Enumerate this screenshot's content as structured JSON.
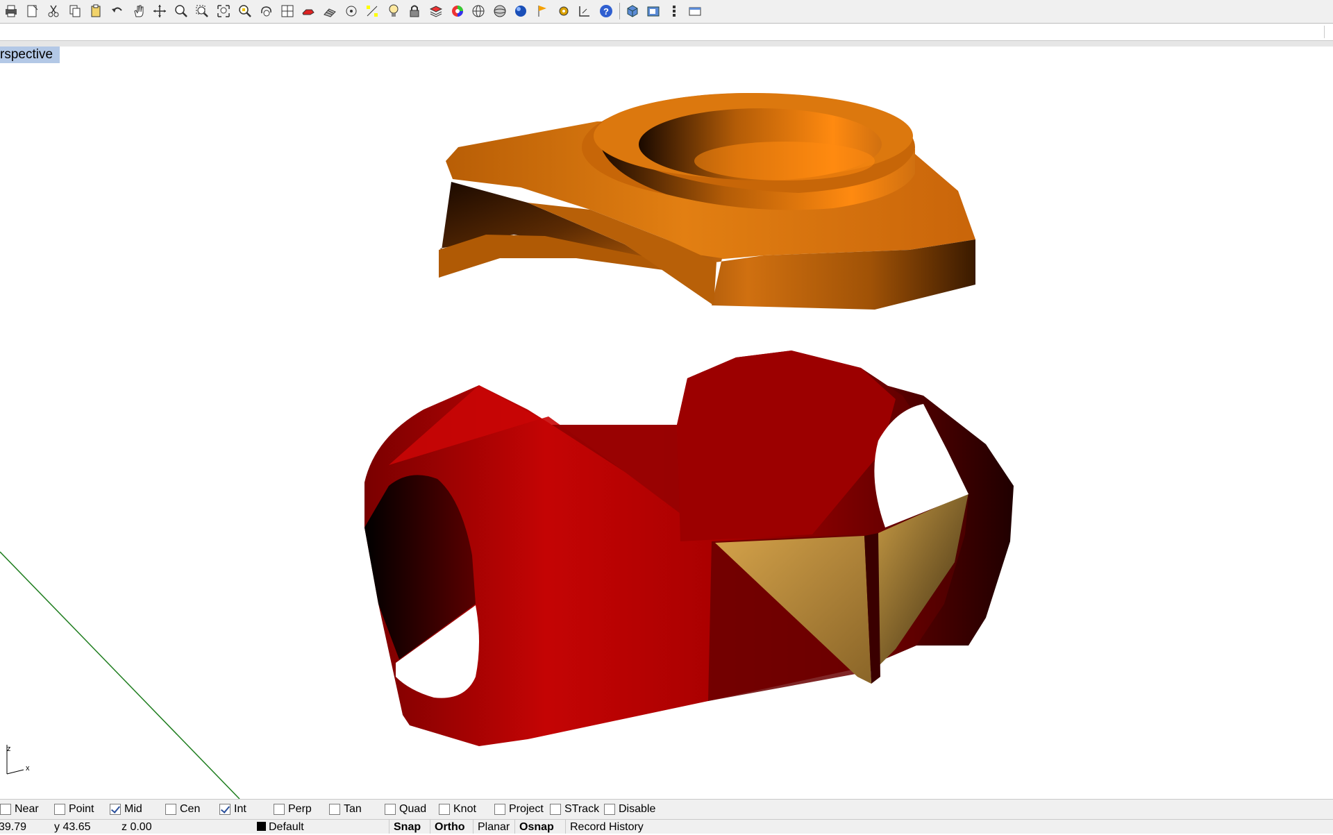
{
  "toolbar": {
    "buttons": [
      {
        "icon": "print-icon",
        "label": "Print"
      },
      {
        "icon": "page-setup-icon",
        "label": "Page setup"
      },
      {
        "icon": "cut-icon",
        "label": "Cut"
      },
      {
        "icon": "copy-icon",
        "label": "Copy"
      },
      {
        "icon": "paste-icon",
        "label": "Paste"
      },
      {
        "icon": "undo-icon",
        "label": "Undo"
      },
      {
        "icon": "pan-hand-icon",
        "label": "Pan"
      },
      {
        "icon": "rotate-view-icon",
        "label": "Rotate view"
      },
      {
        "icon": "zoom-dynamic-icon",
        "label": "Zoom"
      },
      {
        "icon": "zoom-window-icon",
        "label": "Zoom window"
      },
      {
        "icon": "zoom-extents-icon",
        "label": "Zoom extents"
      },
      {
        "icon": "zoom-selected-icon",
        "label": "Zoom selected"
      },
      {
        "icon": "undo-view-icon",
        "label": "Undo view change"
      },
      {
        "icon": "four-viewports-icon",
        "label": "4 viewports"
      },
      {
        "icon": "select-all-icon",
        "label": "Select"
      },
      {
        "icon": "grid-snap-icon",
        "label": "Grid"
      },
      {
        "icon": "circle-target-icon",
        "label": "Circle"
      },
      {
        "icon": "point-edit-icon",
        "label": "Points"
      },
      {
        "icon": "lightbulb-icon",
        "label": "Lights"
      },
      {
        "icon": "lock-icon",
        "label": "Lock"
      },
      {
        "icon": "layer-icon",
        "label": "Layers"
      },
      {
        "icon": "color-wheel-icon",
        "label": "Color"
      },
      {
        "icon": "wireframe-sphere-icon",
        "label": "Wireframe"
      },
      {
        "icon": "shaded-sphere-icon",
        "label": "Shaded"
      },
      {
        "icon": "render-sphere-icon",
        "label": "Render"
      },
      {
        "icon": "flag-icon",
        "label": "Flag"
      },
      {
        "icon": "gear-icon",
        "label": "Options"
      },
      {
        "icon": "dimension-icon",
        "label": "Dimension"
      },
      {
        "icon": "help-icon",
        "label": "Help"
      },
      {
        "icon": "view-cube-icon",
        "label": "Views"
      },
      {
        "icon": "cplane-icon",
        "label": "CPlane"
      },
      {
        "icon": "vertical-dots-icon",
        "label": "More"
      },
      {
        "icon": "viewport-window-icon",
        "label": "Viewport"
      }
    ]
  },
  "viewport": {
    "title": "rspective",
    "axis_x": "x",
    "axis_z": "z"
  },
  "scene": {
    "colors": {
      "orange_part": "#d9740a",
      "red_part": "#b60000",
      "gold_panel": "#c79a3e",
      "axis_line": "#1e7d1e"
    }
  },
  "osnap": [
    {
      "label": "Near",
      "checked": false
    },
    {
      "label": "Point",
      "checked": false
    },
    {
      "label": "Mid",
      "checked": true
    },
    {
      "label": "Cen",
      "checked": false
    },
    {
      "label": "Int",
      "checked": true
    },
    {
      "label": "Perp",
      "checked": false
    },
    {
      "label": "Tan",
      "checked": false
    },
    {
      "label": "Quad",
      "checked": false
    },
    {
      "label": "Knot",
      "checked": false
    },
    {
      "label": "Project",
      "checked": false
    },
    {
      "label": "STrack",
      "checked": false
    },
    {
      "label": "Disable",
      "checked": false
    }
  ],
  "status": {
    "x": "39.79",
    "y": "y 43.65",
    "z": "z 0.00",
    "layer": "Default",
    "snap": "Snap",
    "ortho": "Ortho",
    "planar": "Planar",
    "osnap": "Osnap",
    "record_history": "Record History"
  }
}
